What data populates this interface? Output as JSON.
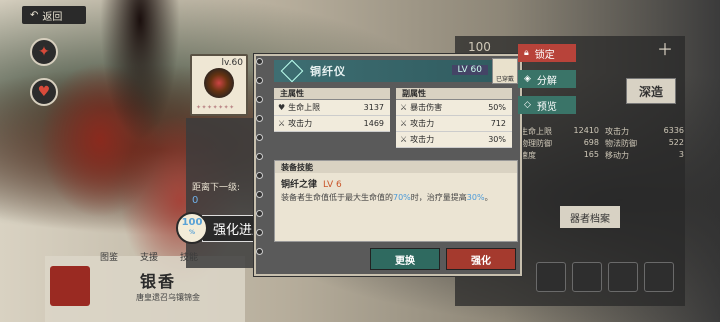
{
  "top": {
    "back_label": "返回"
  },
  "background": {
    "pct": "100",
    "deep_label": "深造",
    "archive_label": "器者档案",
    "tabs": [
      "图鉴",
      "支援",
      "技能"
    ],
    "char_name": "银香",
    "char_sub": "唐皇遗召乌镶锦金",
    "stats": [
      [
        "生命上限",
        "12410",
        "攻击力",
        "6336"
      ],
      [
        "物理防御",
        "698",
        "物法防御",
        "522"
      ],
      [
        "速度",
        "165",
        "移动力",
        "3"
      ]
    ]
  },
  "item": {
    "level": "lv.60",
    "distance_label": "距离下一级:",
    "distance_value": "0",
    "progress_pct": "100",
    "progress_label": "强化进度"
  },
  "card": {
    "name": "铜纤仪",
    "level": "LV 60",
    "equipped_label": "已穿戴",
    "main_attr_title": "主属性",
    "main_attrs": [
      {
        "name": "生命上限",
        "value": "3137"
      },
      {
        "name": "攻击力",
        "value": "1469"
      }
    ],
    "sub_attr_title": "副属性",
    "sub_attrs": [
      {
        "name": "暴击伤害",
        "value": "50%"
      },
      {
        "name": "攻击力",
        "value": "712"
      },
      {
        "name": "攻击力",
        "value": "30%"
      }
    ],
    "skill_title": "装备技能",
    "skill_name": "铜纤之律",
    "skill_level": "LV 6",
    "skill_desc_1": "装备者生命值低于最大生命值的",
    "skill_hl_1": "70%",
    "skill_desc_2": "时，治疗量提高",
    "skill_hl_2": "30%",
    "skill_desc_3": "。",
    "replace_label": "更换",
    "upgrade_label": "强化"
  },
  "side": {
    "lock_label": "锁定",
    "decompose_label": "分解",
    "preview_label": "预览"
  },
  "colors": {
    "header_teal": "#3e6e72",
    "replace_green": "#2f6a60",
    "upgrade_red": "#a53a2e",
    "lock_red": "#b8433a",
    "highlight_blue": "#4a9ad8",
    "skill_level_orange": "#c9552a"
  }
}
